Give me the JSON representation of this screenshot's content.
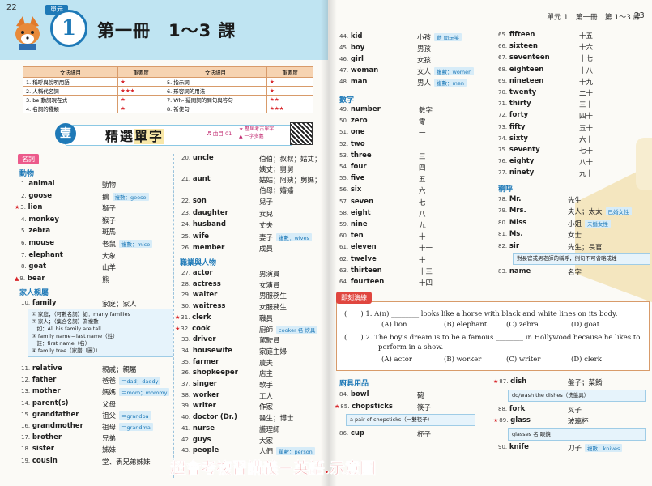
{
  "left": {
    "page_number": "22",
    "unit_label": "單元",
    "unit_number": "1",
    "title": "第一冊　1～3 課",
    "grammar_table": {
      "headers": [
        "文法細目",
        "重要度",
        "文法細目",
        "重要度"
      ],
      "rows": [
        [
          "1. 稱呼與說明用語",
          "★",
          "5. 指示詞",
          "★"
        ],
        [
          "2. 人稱代名詞",
          "★★★",
          "6. 形容詞的用法",
          "★"
        ],
        [
          "3. be 動詞現在式",
          "★",
          "7. Wh- 疑問詞的問句與答句",
          "★★"
        ],
        [
          "4. 名詞的種類",
          "★",
          "8. 祈使句",
          "★★★"
        ]
      ]
    },
    "section": {
      "number": "壹",
      "title_plain": "精選",
      "title_highlight": "單字",
      "track": "♬ 曲目 01",
      "tips": [
        "★ 歷屆考古單字",
        "▲ 一字多義"
      ]
    },
    "col1": {
      "category": "名詞",
      "sub1": "動物",
      "animals": [
        {
          "n": "1.",
          "w": "animal",
          "c": "動物",
          "tag": "",
          "mark": ""
        },
        {
          "n": "2.",
          "w": "goose",
          "c": "鵝",
          "tag": "複數：geese",
          "mark": ""
        },
        {
          "n": "3.",
          "w": "lion",
          "c": "獅子",
          "tag": "",
          "mark": "★"
        },
        {
          "n": "4.",
          "w": "monkey",
          "c": "猴子",
          "tag": "",
          "mark": ""
        },
        {
          "n": "5.",
          "w": "zebra",
          "c": "斑馬",
          "tag": "",
          "mark": ""
        },
        {
          "n": "6.",
          "w": "mouse",
          "c": "老鼠",
          "tag": "複數：mice",
          "mark": ""
        },
        {
          "n": "7.",
          "w": "elephant",
          "c": "大象",
          "tag": "",
          "mark": ""
        },
        {
          "n": "8.",
          "w": "goat",
          "c": "山羊",
          "tag": "",
          "mark": ""
        },
        {
          "n": "9.",
          "w": "bear",
          "c": "熊",
          "tag": "",
          "mark": "▲"
        }
      ],
      "sub2": "家人親屬",
      "family_entry": {
        "n": "10.",
        "w": "family",
        "c": "家庭；家人"
      },
      "family_note": [
        "① 家庭；（可數名詞）如：many families",
        "② 家人；（集合名詞）為複數",
        "　如：All his family are tall.",
        "③ family name＝last name（姓）",
        "　註：first name（名）",
        "④ family tree（家譜〔圖〕）"
      ],
      "relatives": [
        {
          "n": "11.",
          "w": "relative",
          "c": "親戚；親屬",
          "tag": ""
        },
        {
          "n": "12.",
          "w": "father",
          "c": "爸爸",
          "tag": "＝dad；daddy"
        },
        {
          "n": "13.",
          "w": "mother",
          "c": "媽媽",
          "tag": "＝mom；mommy"
        },
        {
          "n": "14.",
          "w": "parent(s)",
          "c": "父母",
          "tag": ""
        },
        {
          "n": "15.",
          "w": "grandfather",
          "c": "祖父",
          "tag": "＝grandpa"
        },
        {
          "n": "16.",
          "w": "grandmother",
          "c": "祖母",
          "tag": "＝grandma"
        },
        {
          "n": "17.",
          "w": "brother",
          "c": "兄弟",
          "tag": ""
        },
        {
          "n": "18.",
          "w": "sister",
          "c": "姊妹",
          "tag": ""
        },
        {
          "n": "19.",
          "w": "cousin",
          "c": "堂、表兄弟姊妹",
          "tag": ""
        }
      ]
    },
    "col2": {
      "uncle": {
        "n": "20.",
        "w": "uncle",
        "c1": "伯伯；叔叔；姑丈；",
        "c2": "姨丈；舅舅"
      },
      "aunt": {
        "n": "21.",
        "w": "aunt",
        "c1": "姑姑；阿姨；舅媽；",
        "c2": "伯母；嬸嬸"
      },
      "family2": [
        {
          "n": "22.",
          "w": "son",
          "c": "兒子",
          "tag": ""
        },
        {
          "n": "23.",
          "w": "daughter",
          "c": "女兒",
          "tag": ""
        },
        {
          "n": "24.",
          "w": "husband",
          "c": "丈夫",
          "tag": ""
        },
        {
          "n": "25.",
          "w": "wife",
          "c": "妻子",
          "tag": "複數：wives"
        },
        {
          "n": "26.",
          "w": "member",
          "c": "成員",
          "tag": ""
        }
      ],
      "sub3": "職業與人物",
      "jobs": [
        {
          "n": "27.",
          "w": "actor",
          "c": "男演員",
          "tag": "",
          "mark": ""
        },
        {
          "n": "28.",
          "w": "actress",
          "c": "女演員",
          "tag": "",
          "mark": ""
        },
        {
          "n": "29.",
          "w": "waiter",
          "c": "男服務生",
          "tag": "",
          "mark": ""
        },
        {
          "n": "30.",
          "w": "waitress",
          "c": "女服務生",
          "tag": "",
          "mark": ""
        },
        {
          "n": "31.",
          "w": "clerk",
          "c": "職員",
          "tag": "",
          "mark": "★"
        },
        {
          "n": "32.",
          "w": "cook",
          "c": "廚師",
          "tag": "cooker 名 炊具",
          "mark": "★"
        },
        {
          "n": "33.",
          "w": "driver",
          "c": "駕駛員",
          "tag": "",
          "mark": ""
        },
        {
          "n": "34.",
          "w": "housewife",
          "c": "家庭主婦",
          "tag": "",
          "mark": ""
        },
        {
          "n": "35.",
          "w": "farmer",
          "c": "農夫",
          "tag": "",
          "mark": ""
        },
        {
          "n": "36.",
          "w": "shopkeeper",
          "c": "店主",
          "tag": "",
          "mark": ""
        },
        {
          "n": "37.",
          "w": "singer",
          "c": "歌手",
          "tag": "",
          "mark": ""
        },
        {
          "n": "38.",
          "w": "worker",
          "c": "工人",
          "tag": "",
          "mark": ""
        },
        {
          "n": "39.",
          "w": "writer",
          "c": "作家",
          "tag": "",
          "mark": ""
        },
        {
          "n": "40.",
          "w": "doctor (Dr.)",
          "c": "醫生；博士",
          "tag": "",
          "mark": ""
        },
        {
          "n": "41.",
          "w": "nurse",
          "c": "護理師",
          "tag": "",
          "mark": ""
        },
        {
          "n": "42.",
          "w": "guys",
          "c": "大家",
          "tag": "",
          "mark": ""
        },
        {
          "n": "43.",
          "w": "people",
          "c": "人們",
          "tag": "單數：person",
          "mark": ""
        }
      ]
    }
  },
  "right": {
    "running_head": "單元 1　第一冊　第 1～3 課",
    "page_number": "23",
    "col1_people": [
      {
        "n": "44.",
        "w": "kid",
        "c": "小孩",
        "tag": "動 開玩笑"
      },
      {
        "n": "45.",
        "w": "boy",
        "c": "男孩",
        "tag": ""
      },
      {
        "n": "46.",
        "w": "girl",
        "c": "女孩",
        "tag": ""
      },
      {
        "n": "47.",
        "w": "woman",
        "c": "女人",
        "tag": "複數：women"
      },
      {
        "n": "48.",
        "w": "man",
        "c": "男人",
        "tag": "複數：men"
      }
    ],
    "numbers_label": "數字",
    "numbers1": [
      {
        "n": "49.",
        "w": "number",
        "c": "數字"
      },
      {
        "n": "50.",
        "w": "zero",
        "c": "零"
      },
      {
        "n": "51.",
        "w": "one",
        "c": "一"
      },
      {
        "n": "52.",
        "w": "two",
        "c": "二"
      },
      {
        "n": "53.",
        "w": "three",
        "c": "三"
      },
      {
        "n": "54.",
        "w": "four",
        "c": "四"
      },
      {
        "n": "55.",
        "w": "five",
        "c": "五"
      },
      {
        "n": "56.",
        "w": "six",
        "c": "六"
      },
      {
        "n": "57.",
        "w": "seven",
        "c": "七"
      },
      {
        "n": "58.",
        "w": "eight",
        "c": "八"
      },
      {
        "n": "59.",
        "w": "nine",
        "c": "九"
      },
      {
        "n": "60.",
        "w": "ten",
        "c": "十"
      },
      {
        "n": "61.",
        "w": "eleven",
        "c": "十一"
      },
      {
        "n": "62.",
        "w": "twelve",
        "c": "十二"
      },
      {
        "n": "63.",
        "w": "thirteen",
        "c": "十三"
      },
      {
        "n": "64.",
        "w": "fourteen",
        "c": "十四"
      }
    ],
    "numbers2": [
      {
        "n": "65.",
        "w": "fifteen",
        "c": "十五"
      },
      {
        "n": "66.",
        "w": "sixteen",
        "c": "十六"
      },
      {
        "n": "67.",
        "w": "seventeen",
        "c": "十七"
      },
      {
        "n": "68.",
        "w": "eighteen",
        "c": "十八"
      },
      {
        "n": "69.",
        "w": "nineteen",
        "c": "十九"
      },
      {
        "n": "70.",
        "w": "twenty",
        "c": "二十"
      },
      {
        "n": "71.",
        "w": "thirty",
        "c": "三十"
      },
      {
        "n": "72.",
        "w": "forty",
        "c": "四十"
      },
      {
        "n": "73.",
        "w": "fifty",
        "c": "五十"
      },
      {
        "n": "74.",
        "w": "sixty",
        "c": "六十"
      },
      {
        "n": "75.",
        "w": "seventy",
        "c": "七十"
      },
      {
        "n": "76.",
        "w": "eighty",
        "c": "八十"
      },
      {
        "n": "77.",
        "w": "ninety",
        "c": "九十"
      }
    ],
    "titles_label": "稱呼",
    "titles": [
      {
        "n": "78.",
        "w": "Mr.",
        "c": "先生",
        "tag": ""
      },
      {
        "n": "79.",
        "w": "Mrs.",
        "c": "夫人；太太",
        "tag": "已婚女性"
      },
      {
        "n": "80.",
        "w": "Miss",
        "c": "小姐",
        "tag": "未婚女性"
      },
      {
        "n": "81.",
        "w": "Ms.",
        "c": "女士",
        "tag": ""
      },
      {
        "n": "82.",
        "w": "sir",
        "c": "先生；長官",
        "tag": ""
      }
    ],
    "sir_note": "對長官或男老師的稱呼，例句不可省略成姓",
    "name_entry": {
      "n": "83.",
      "w": "name",
      "c": "名字"
    },
    "quiz": {
      "tag": "即刻演練",
      "q1": "(　　) 1. A(n) ________ looks like a horse with black and white lines on its body.",
      "q1_opts": [
        "(A) lion",
        "(B) elephant",
        "(C) zebra",
        "(D) goat"
      ],
      "q2a": "(　　) 2. The boy's dream is to be a famous ________ in Hollywood because he likes to",
      "q2b": "perform in a show.",
      "q2_opts": [
        "(A) actor",
        "(B) worker",
        "(C) writer",
        "(D) clerk"
      ]
    },
    "kitchen_label": "廚具用品",
    "kitchen1": [
      {
        "n": "84.",
        "w": "bowl",
        "c": "碗",
        "mark": ""
      },
      {
        "n": "85.",
        "w": "chopsticks",
        "c": "筷子",
        "mark": "★"
      }
    ],
    "chop_note": "a pair of chopsticks（一雙筷子）",
    "cup": {
      "n": "86.",
      "w": "cup",
      "c": "杯子"
    },
    "kitchen2": [
      {
        "n": "87.",
        "w": "dish",
        "c": "盤子；菜餚",
        "mark": "★"
      }
    ],
    "dish_note": "do/wash the dishes（洗盤具）",
    "fork": {
      "n": "88.",
      "w": "fork",
      "c": "叉子"
    },
    "glass": {
      "n": "89.",
      "w": "glass",
      "c": "玻璃杯",
      "mark": "★"
    },
    "glass_note": "glasses 名 眼鏡",
    "knife": {
      "n": "90.",
      "w": "knife",
      "c": "刀子",
      "tag": "複數：knives"
    }
  },
  "watermark": "超會考複習講義－英語.示意圖",
  "colors": {
    "accent": "#1e79b7",
    "pink": "#ec5a8b",
    "red": "#d8262b",
    "band": "#bfe4f2"
  }
}
